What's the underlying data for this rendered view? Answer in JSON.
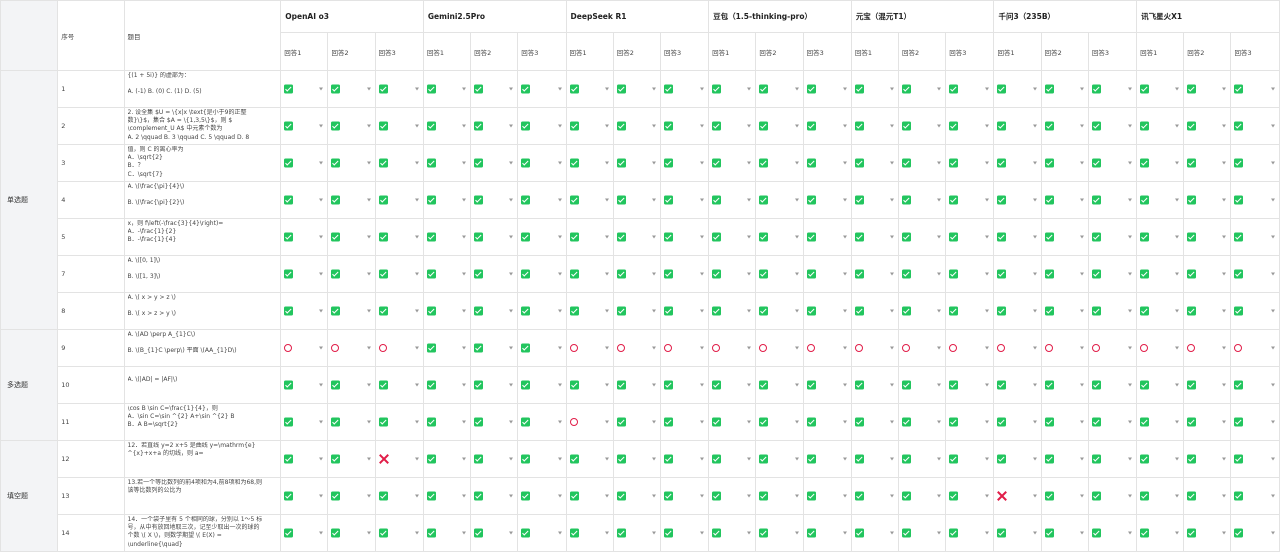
{
  "header": {
    "col_index": "序号",
    "col_question": "题目",
    "models": [
      "OpenAI o3",
      "Gemini2.5Pro",
      "DeepSeek R1",
      "豆包（1.5-thinking-pro）",
      "元宝（混元T1）",
      "千问3（235B）",
      "讯飞星火X1"
    ],
    "answers": [
      "回答1",
      "回答2",
      "回答3"
    ]
  },
  "categories": [
    {
      "label": "单选题",
      "span": 7
    },
    {
      "label": "多选题",
      "span": 3
    },
    {
      "label": "填空题",
      "span": 3
    }
  ],
  "rows": [
    {
      "num": "1",
      "q": [
        "{(1 + 5i)} 的虚部为：",
        "",
        "A. (-1) B. (0) C. (1) D. (5)"
      ],
      "marks": [
        "c",
        "c",
        "c",
        "c",
        "c",
        "c",
        "c",
        "c",
        "c",
        "c",
        "c",
        "c",
        "c",
        "c",
        "c",
        "c",
        "c",
        "c",
        "c",
        "c",
        "c"
      ]
    },
    {
      "num": "2",
      "q": [
        "2. 设全集 $U = \\{x|x \\text{是小于9的正整",
        "数}\\}$，集合 $A = \\{1,3,5\\}$，则 $",
        "\\complement_U A$ 中元素个数为",
        "A. 2 \\qquad B. 3 \\qquad C. 5 \\qquad D. 8"
      ],
      "marks": [
        "c",
        "c",
        "c",
        "c",
        "c",
        "c",
        "c",
        "c",
        "c",
        "c",
        "c",
        "c",
        "c",
        "c",
        "c",
        "c",
        "c",
        "c",
        "c",
        "c",
        "c"
      ]
    },
    {
      "num": "3",
      "q": [
        "值，则 C 的离心率为",
        "A．\\sqrt{2}",
        "B．？",
        "C．\\sqrt{7}"
      ],
      "marks": [
        "c",
        "c",
        "c",
        "c",
        "c",
        "c",
        "c",
        "c",
        "c",
        "c",
        "c",
        "c",
        "c",
        "c",
        "c",
        "c",
        "c",
        "c",
        "c",
        "c",
        "c"
      ]
    },
    {
      "num": "4",
      "q": [
        "A. \\(\\frac{\\pi}{4}\\)",
        "",
        "B. \\(\\frac{\\pi}{2}\\)"
      ],
      "marks": [
        "c",
        "c",
        "c",
        "c",
        "c",
        "c",
        "c",
        "c",
        "c",
        "c",
        "c",
        "c",
        "c",
        "c",
        "c",
        "c",
        "c",
        "c",
        "c",
        "c",
        "c"
      ]
    },
    {
      "num": "5",
      "q": [
        "x，则 f\\left(-\\frac{3}{4}\\right)=",
        "A．-\\frac{1}{2}",
        "B．-\\frac{1}{4}"
      ],
      "marks": [
        "c",
        "c",
        "c",
        "c",
        "c",
        "c",
        "c",
        "c",
        "c",
        "c",
        "c",
        "c",
        "c",
        "c",
        "c",
        "c",
        "c",
        "c",
        "c",
        "c",
        "c"
      ]
    },
    {
      "num": "7",
      "q": [
        "A. \\([0, 1]\\)",
        "",
        "B. \\([1, 3]\\)"
      ],
      "marks": [
        "c",
        "c",
        "c",
        "c",
        "c",
        "c",
        "c",
        "c",
        "c",
        "c",
        "c",
        "c",
        "c",
        "c",
        "c",
        "c",
        "c",
        "c",
        "c",
        "c",
        "c"
      ]
    },
    {
      "num": "8",
      "q": [
        "A. \\( x > y > z \\)",
        "",
        "B. \\( x > z > y \\)"
      ],
      "marks": [
        "c",
        "c",
        "c",
        "c",
        "c",
        "c",
        "c",
        "c",
        "c",
        "c",
        "c",
        "c",
        "c",
        "c",
        "c",
        "c",
        "c",
        "c",
        "c",
        "c",
        "c"
      ]
    },
    {
      "num": "9",
      "q": [
        "A. \\(AD \\perp A_{1}C\\)",
        "",
        "B. \\(B_{1}C \\perp\\) 平面 \\(AA_{1}D\\)"
      ],
      "marks": [
        "o",
        "o",
        "o",
        "c",
        "c",
        "c",
        "o",
        "o",
        "o",
        "o",
        "o",
        "o",
        "o",
        "o",
        "o",
        "o",
        "o",
        "o",
        "o",
        "o",
        "o"
      ]
    },
    {
      "num": "10",
      "q": [
        "",
        "A. \\(|AD| = |AF|\\)",
        ""
      ],
      "marks": [
        "c",
        "c",
        "c",
        "c",
        "c",
        "c",
        "c",
        "c",
        "c",
        "c",
        "c",
        "c",
        "c",
        "c",
        "c",
        "c",
        "c",
        "c",
        "c",
        "c",
        "c"
      ]
    },
    {
      "num": "11",
      "q": [
        "\\cos B \\sin C=\\frac{1}{4}，则",
        "A．\\sin C=\\sin ^{2} A+\\sin ^{2} B",
        "B．A B=\\sqrt{2}"
      ],
      "marks": [
        "c",
        "c",
        "c",
        "c",
        "c",
        "c",
        "o",
        "c",
        "c",
        "c",
        "c",
        "c",
        "c",
        "c",
        "c",
        "c",
        "c",
        "c",
        "c",
        "c",
        "c"
      ]
    },
    {
      "num": "12",
      "q": [
        "12．若直线 y=2 x+5 是曲线 y=\\mathrm{e}",
        "^{x}+x+a 的切线，则 a="
      ],
      "marks": [
        "c",
        "c",
        "x",
        "c",
        "c",
        "c",
        "c",
        "c",
        "c",
        "c",
        "c",
        "c",
        "c",
        "c",
        "c",
        "c",
        "c",
        "c",
        "c",
        "c",
        "c"
      ]
    },
    {
      "num": "13",
      "q": [
        "13.若一个等比数列的前4项和为4,前8项和为68,则",
        "该等比数列的公比为"
      ],
      "marks": [
        "c",
        "c",
        "c",
        "c",
        "c",
        "c",
        "c",
        "c",
        "c",
        "c",
        "c",
        "c",
        "c",
        "c",
        "c",
        "x",
        "c",
        "c",
        "c",
        "c",
        "c"
      ]
    },
    {
      "num": "14",
      "q": [
        "14．一个袋子里有 5 个相同的球，分别以 1～5 标",
        "号，从中有放回地取三次，记至少取出一次的球的",
        "个数 \\( X \\)，则数学期望 \\( E(X) =",
        "\\underline{\\quad}"
      ],
      "marks": [
        "c",
        "c",
        "c",
        "c",
        "c",
        "c",
        "c",
        "c",
        "c",
        "c",
        "c",
        "c",
        "c",
        "c",
        "c",
        "c",
        "c",
        "c",
        "c",
        "c",
        "c"
      ]
    }
  ]
}
